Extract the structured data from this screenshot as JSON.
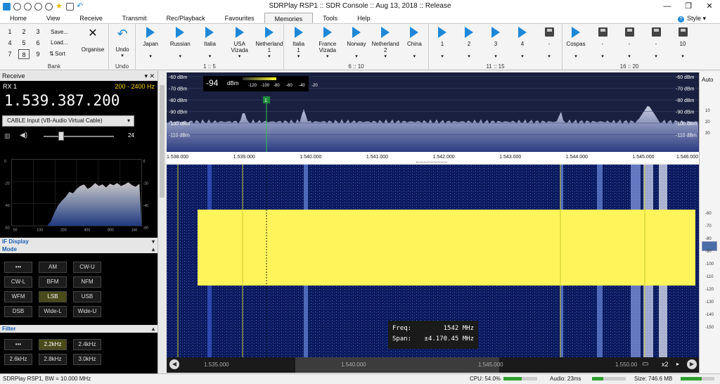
{
  "window": {
    "title": "SDRPlay RSP1 :: SDR Console :: Aug 13, 2018 :: Release",
    "style_label": "Style"
  },
  "menu": [
    "Home",
    "View",
    "Receive",
    "Transmit",
    "Rec/Playback",
    "Favourites",
    "Memories",
    "Tools",
    "Help"
  ],
  "ribbon": {
    "bank_digits": [
      "1",
      "2",
      "3",
      "4",
      "5",
      "6",
      "7",
      "8",
      "9"
    ],
    "bank_actions": [
      "Save...",
      "Load...",
      "Sort"
    ],
    "organise": "Organise",
    "undo": "Undo",
    "g1": [
      {
        "l": "Japan",
        "d": "▾"
      },
      {
        "l": "Russian",
        "d": "▾"
      },
      {
        "l": "Italia",
        "d": "▾"
      },
      {
        "l": "USA\nVizada",
        "d": "▾"
      },
      {
        "l": "Netherland\n1",
        "d": "▾"
      }
    ],
    "g2": [
      {
        "l": "Italia\n1",
        "d": "▾"
      },
      {
        "l": "France\nVizada",
        "d": "▾"
      },
      {
        "l": "Norway",
        "d": "▾"
      },
      {
        "l": "Netherland\n2",
        "d": "▾"
      },
      {
        "l": "China",
        "d": "▾"
      }
    ],
    "g3": [
      {
        "l": "1",
        "d": "▾"
      },
      {
        "l": "2",
        "d": "▾"
      },
      {
        "l": "3",
        "d": "▾"
      },
      {
        "l": "4",
        "d": "▾"
      },
      {
        "l": "-",
        "d": "▾"
      }
    ],
    "g4": [
      {
        "l": "Cospas",
        "d": "▾"
      },
      {
        "l": "-",
        "d": "▾"
      },
      {
        "l": "-",
        "d": "▾"
      },
      {
        "l": "-",
        "d": "▾"
      },
      {
        "l": "10",
        "d": "▾"
      }
    ],
    "group_labels": [
      "Bank",
      "Undo",
      "1 :: 5",
      "6 :: 10",
      "11 :: 15",
      "16 :: 20"
    ]
  },
  "receive": {
    "panel": "Receive",
    "rx": "RX 1",
    "range": "200 - 2400 Hz",
    "freq": "1.539.387.200",
    "input": "CABLE Input (VB-Audio Virtual Cable)",
    "volume": "24",
    "volume_level": 0.25,
    "if_y": [
      "0",
      "-20",
      "-40",
      "-60"
    ],
    "if_x": [
      "50",
      "100",
      "200",
      "400",
      "800",
      "1k6"
    ]
  },
  "ifdisplay": "IF Display",
  "mode": {
    "title": "Mode",
    "buttons": [
      "•••",
      "AM",
      "CW-U",
      "CW-L",
      "BFM",
      "NFM",
      "WFM",
      "LSB",
      "USB",
      "DSB",
      "Wide-L",
      "Wide-U"
    ],
    "selected": "LSB"
  },
  "filter": {
    "title": "Filter",
    "buttons": [
      "•••",
      "2.2kHz",
      "2.4kHz",
      "2.6kHz",
      "2.8kHz",
      "3.0kHz"
    ],
    "selected": "2.2kHz"
  },
  "spectrum": {
    "level": "-94",
    "unit": "dBm",
    "meter_ticks": [
      "-120",
      "-100",
      "-80",
      "-60",
      "-40",
      "-20"
    ],
    "dbm_left": [
      "-60 dBm",
      "-70 dBm",
      "-80 dBm",
      "-90 dBm",
      "-100 dBm",
      "-110 dBm"
    ],
    "dbm_right": [
      "-60 dBm",
      "-70 dBm",
      "-80 dBm",
      "-90 dBm",
      "-100 dBm",
      "-110 dBm"
    ],
    "axis": [
      "1.538.000",
      "1.539.000",
      "1.540.000",
      "1.541.000",
      "1.542.000",
      "1.543.000",
      "1.544.000",
      "1.545.000",
      "1.546.000"
    ],
    "marker": "1"
  },
  "waterfall": {
    "freq_label": "Freq:",
    "freq_value": "1542 MHz",
    "span_label": "Span:",
    "span_value": "±4.170.45 MHz",
    "bottom_axis": [
      "1.535.000",
      "1.540.000",
      "1.545.000",
      "1.550.00"
    ],
    "zoom": "x2"
  },
  "right_scale": {
    "auto": "Auto",
    "ticks": [
      "-60",
      "-70",
      "-80",
      "-90",
      "-100",
      "-110",
      "-120",
      "-130",
      "-140",
      "-150",
      "10",
      "20",
      "30"
    ]
  },
  "status": {
    "device": "SDRPlay RSP1, BW = 10.000 MHz",
    "cpu": "CPU: 54.0%",
    "audio": "Audio: 23ms",
    "size": "Size: 746.6 MB"
  },
  "colors": {
    "accent": "#1e88d8",
    "waterfall_signal": "#ffff00",
    "spectrum_bg": "#1a2140"
  }
}
